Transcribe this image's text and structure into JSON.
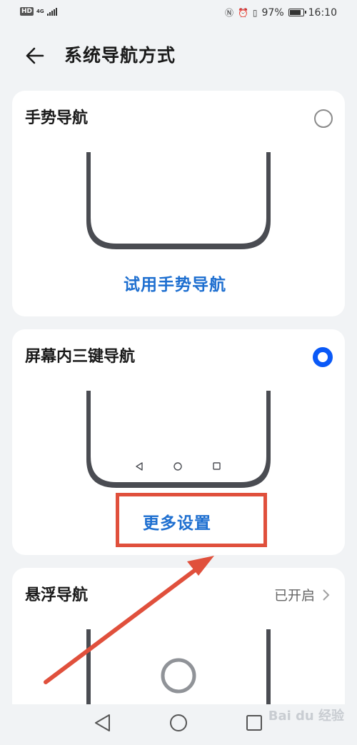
{
  "status_bar": {
    "hd_label": "HD",
    "network_label": "4G",
    "battery": "97%",
    "battery_level": 0.97,
    "time": "16:10"
  },
  "header": {
    "title": "系统导航方式",
    "back_icon": "arrow-left-icon"
  },
  "options": [
    {
      "title": "手势导航",
      "link": "试用手势导航",
      "selected": false
    },
    {
      "title": "屏幕内三键导航",
      "link": "更多设置",
      "selected": true,
      "keys": [
        "triangle-back-icon",
        "circle-home-icon",
        "square-recents-icon"
      ]
    },
    {
      "title": "悬浮导航",
      "status": "已开启",
      "selected": false
    }
  ],
  "nav_bar": {
    "icons": [
      "triangle-back-icon",
      "circle-home-icon",
      "square-recents-icon"
    ]
  },
  "watermark": "Bai du 经验",
  "colors": {
    "accent": "#0a59f7",
    "link": "#1e6fd0",
    "annotation": "#e0503c",
    "background": "#f1f3f5"
  }
}
